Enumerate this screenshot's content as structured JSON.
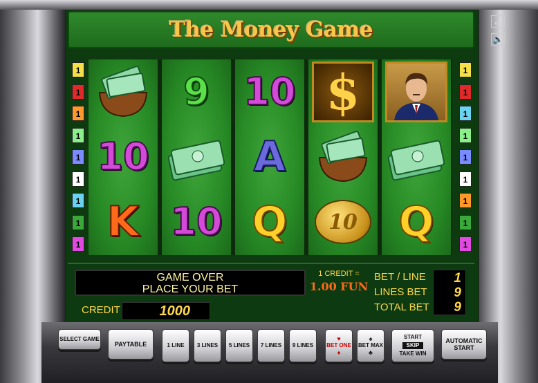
{
  "title": "The Money Game",
  "top_icons": [
    "fullscreen-icon",
    "speaker-icon"
  ],
  "line_indicators_left": [
    {
      "label": "1",
      "color": "#f5e04a"
    },
    {
      "label": "1",
      "color": "#e02a2a"
    },
    {
      "label": "1",
      "color": "#ff9a2a"
    },
    {
      "label": "1",
      "color": "#8af08a"
    },
    {
      "label": "1",
      "color": "#7a8aff"
    },
    {
      "label": "1",
      "color": "#ffffff"
    },
    {
      "label": "1",
      "color": "#6ad4f0"
    },
    {
      "label": "1",
      "color": "#3aa83a"
    },
    {
      "label": "1",
      "color": "#e04ae0"
    }
  ],
  "line_indicators_right": [
    {
      "label": "1",
      "color": "#f5e04a"
    },
    {
      "label": "1",
      "color": "#e02a2a"
    },
    {
      "label": "1",
      "color": "#6ad4f0"
    },
    {
      "label": "1",
      "color": "#8af08a"
    },
    {
      "label": "1",
      "color": "#7a8aff"
    },
    {
      "label": "1",
      "color": "#ffffff"
    },
    {
      "label": "1",
      "color": "#ff9a2a"
    },
    {
      "label": "1",
      "color": "#3aa83a"
    },
    {
      "label": "1",
      "color": "#e04ae0"
    }
  ],
  "reels": [
    [
      "wallet",
      "10",
      "K"
    ],
    [
      "9",
      "cash",
      "10"
    ],
    [
      "10",
      "A",
      "Q"
    ],
    [
      "dollar",
      "wallet",
      "coin"
    ],
    [
      "man",
      "cash",
      "Q"
    ]
  ],
  "reel_text": {
    "r0_s1": "10",
    "r0_s2": "K",
    "r1_s0": "9",
    "r1_s2": "10",
    "r2_s0": "10",
    "r2_s1": "A",
    "r2_s2": "Q",
    "r3_s0": "$",
    "r3_coin": "10",
    "r4_s2": "Q"
  },
  "message": {
    "line1": "GAME OVER",
    "line2": "PLACE YOUR BET"
  },
  "credit": {
    "label": "CREDIT",
    "value": "1000"
  },
  "credit_rate": {
    "line1": "1 CREDIT =",
    "line2": "1.00 FUN"
  },
  "bets": {
    "bet_line_label": "BET / LINE",
    "bet_line_value": "1",
    "lines_bet_label": "LINES BET",
    "lines_bet_value": "9",
    "total_bet_label": "TOTAL BET",
    "total_bet_value": "9"
  },
  "buttons": {
    "select_game": "SELECT GAME",
    "paytable": "PAYTABLE",
    "line1": "1 LINE",
    "line3": "3 LINES",
    "line5": "5 LINES",
    "line7": "7 LINES",
    "line9": "9 LINES",
    "bet_one": "BET ONE",
    "bet_max": "BET MAX",
    "start_skip_1": "START",
    "start_skip_2": "SKIP",
    "start_skip_3": "TAKE WIN",
    "auto_start_1": "AUTOMATIC",
    "auto_start_2": "START"
  }
}
